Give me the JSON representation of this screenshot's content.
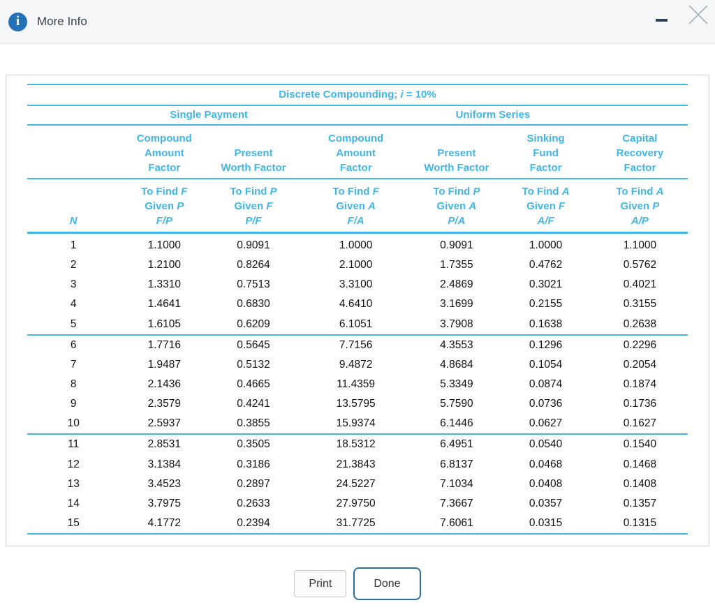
{
  "titlebar": {
    "title": "More Info"
  },
  "icons": {
    "info": "i",
    "minimize": "minimize-dash",
    "close": "close-x"
  },
  "table": {
    "title": {
      "pre": "Discrete Compounding; ",
      "var": "i",
      "post": " = 10%"
    },
    "groups": {
      "single_payment": "Single Payment",
      "uniform_series": "Uniform Series"
    },
    "n_header": "N",
    "columns": [
      {
        "name": "Compound\nAmount\nFactor",
        "find_pre": "To Find ",
        "find_var": "F",
        "given_pre": "Given ",
        "given_var": "P",
        "symbol": "F/P"
      },
      {
        "name": "Present\nWorth Factor",
        "find_pre": "To Find ",
        "find_var": "P",
        "given_pre": "Given ",
        "given_var": "F",
        "symbol": "P/F"
      },
      {
        "name": "Compound\nAmount\nFactor",
        "find_pre": "To Find ",
        "find_var": "F",
        "given_pre": "Given ",
        "given_var": "A",
        "symbol": "F/A"
      },
      {
        "name": "Present\nWorth Factor",
        "find_pre": "To Find ",
        "find_var": "P",
        "given_pre": "Given ",
        "given_var": "A",
        "symbol": "P/A"
      },
      {
        "name": "Sinking\nFund\nFactor",
        "find_pre": "To Find ",
        "find_var": "A",
        "given_pre": "Given ",
        "given_var": "F",
        "symbol": "A/F"
      },
      {
        "name": "Capital\nRecovery\nFactor",
        "find_pre": "To Find ",
        "find_var": "A",
        "given_pre": "Given ",
        "given_var": "P",
        "symbol": "A/P"
      }
    ],
    "rows": [
      [
        "1",
        "1.1000",
        "0.9091",
        "1.0000",
        "0.9091",
        "1.0000",
        "1.1000"
      ],
      [
        "2",
        "1.2100",
        "0.8264",
        "2.1000",
        "1.7355",
        "0.4762",
        "0.5762"
      ],
      [
        "3",
        "1.3310",
        "0.7513",
        "3.3100",
        "2.4869",
        "0.3021",
        "0.4021"
      ],
      [
        "4",
        "1.4641",
        "0.6830",
        "4.6410",
        "3.1699",
        "0.2155",
        "0.3155"
      ],
      [
        "5",
        "1.6105",
        "0.6209",
        "6.1051",
        "3.7908",
        "0.1638",
        "0.2638"
      ],
      [
        "6",
        "1.7716",
        "0.5645",
        "7.7156",
        "4.3553",
        "0.1296",
        "0.2296"
      ],
      [
        "7",
        "1.9487",
        "0.5132",
        "9.4872",
        "4.8684",
        "0.1054",
        "0.2054"
      ],
      [
        "8",
        "2.1436",
        "0.4665",
        "11.4359",
        "5.3349",
        "0.0874",
        "0.1874"
      ],
      [
        "9",
        "2.3579",
        "0.4241",
        "13.5795",
        "5.7590",
        "0.0736",
        "0.1736"
      ],
      [
        "10",
        "2.5937",
        "0.3855",
        "15.9374",
        "6.1446",
        "0.0627",
        "0.1627"
      ],
      [
        "11",
        "2.8531",
        "0.3505",
        "18.5312",
        "6.4951",
        "0.0540",
        "0.1540"
      ],
      [
        "12",
        "3.1384",
        "0.3186",
        "21.3843",
        "6.8137",
        "0.0468",
        "0.1468"
      ],
      [
        "13",
        "3.4523",
        "0.2897",
        "24.5227",
        "7.1034",
        "0.0408",
        "0.1408"
      ],
      [
        "14",
        "3.7975",
        "0.2633",
        "27.9750",
        "7.3667",
        "0.0357",
        "0.1357"
      ],
      [
        "15",
        "4.1772",
        "0.2394",
        "31.7725",
        "7.6061",
        "0.0315",
        "0.1315"
      ]
    ],
    "group_breaks_after": [
      "5",
      "10",
      "15"
    ]
  },
  "buttons": {
    "print": "Print",
    "done": "Done"
  }
}
